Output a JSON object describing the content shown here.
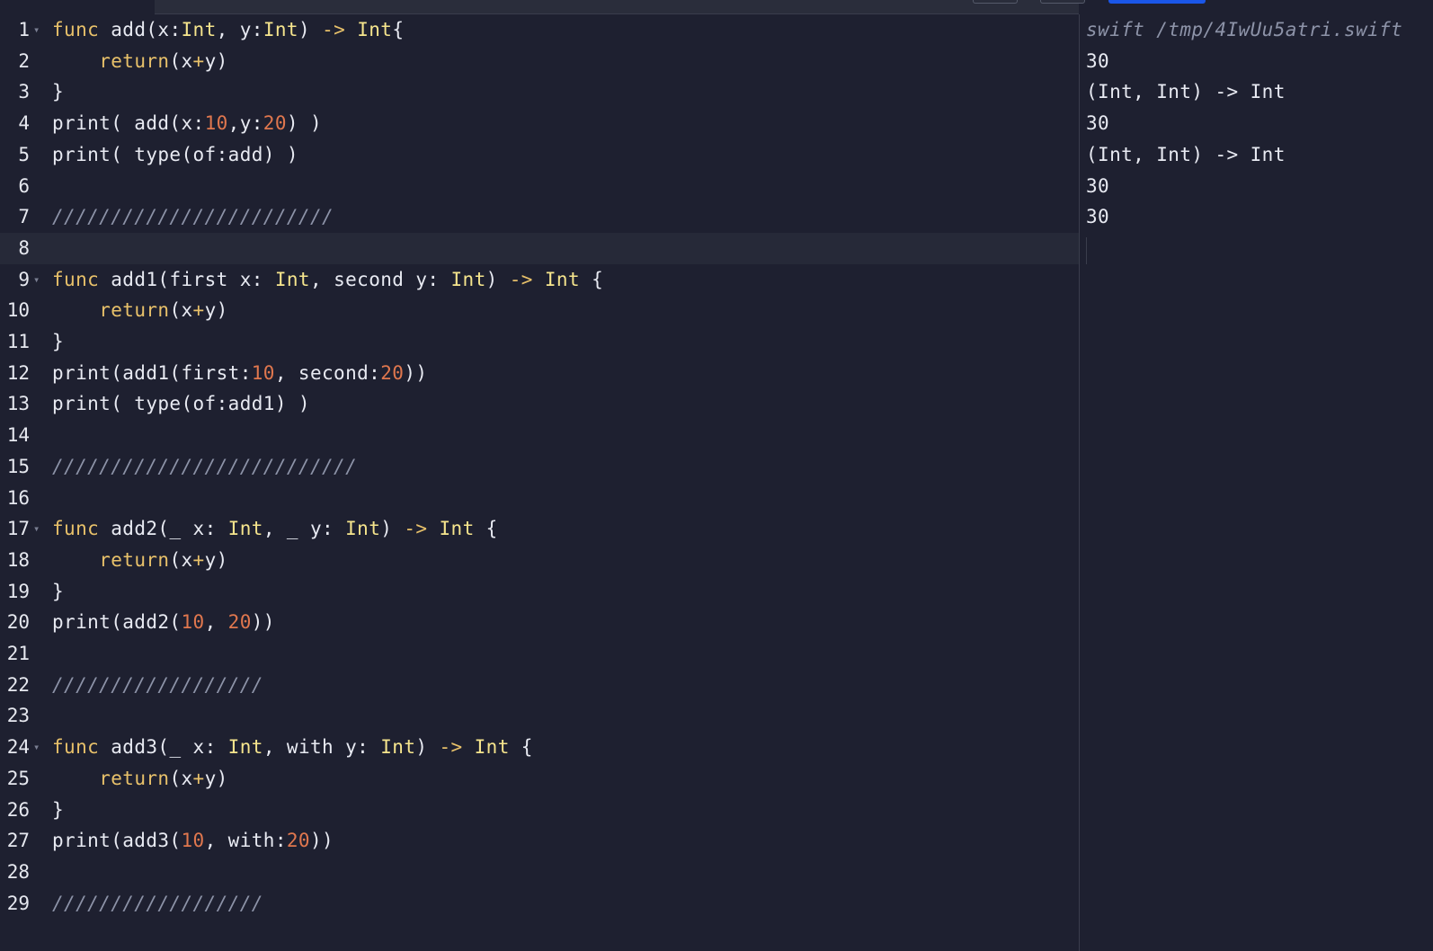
{
  "editor": {
    "lines": [
      {
        "n": "1",
        "fold": true,
        "tokens": [
          [
            "kw",
            "func"
          ],
          [
            "t",
            " add(x:"
          ],
          [
            "ty",
            "Int"
          ],
          [
            "t",
            ", y:"
          ],
          [
            "ty",
            "Int"
          ],
          [
            "t",
            ") "
          ],
          [
            "op",
            "->"
          ],
          [
            "t",
            " "
          ],
          [
            "ty",
            "Int"
          ],
          [
            "t",
            "{"
          ]
        ]
      },
      {
        "n": "2",
        "fold": false,
        "tokens": [
          [
            "t",
            "    "
          ],
          [
            "kw",
            "return"
          ],
          [
            "t",
            "(x"
          ],
          [
            "op",
            "+"
          ],
          [
            "t",
            "y)"
          ]
        ]
      },
      {
        "n": "3",
        "fold": false,
        "tokens": [
          [
            "t",
            "}"
          ]
        ]
      },
      {
        "n": "4",
        "fold": false,
        "tokens": [
          [
            "t",
            "print( add(x:"
          ],
          [
            "num",
            "10"
          ],
          [
            "t",
            ",y:"
          ],
          [
            "num",
            "20"
          ],
          [
            "t",
            ") )"
          ]
        ]
      },
      {
        "n": "5",
        "fold": false,
        "tokens": [
          [
            "t",
            "print( type(of:add) )"
          ]
        ]
      },
      {
        "n": "6",
        "fold": false,
        "tokens": []
      },
      {
        "n": "7",
        "fold": false,
        "tokens": [
          [
            "cm",
            "////////////////////////"
          ]
        ]
      },
      {
        "n": "8",
        "fold": false,
        "active": true,
        "tokens": []
      },
      {
        "n": "9",
        "fold": true,
        "tokens": [
          [
            "kw",
            "func"
          ],
          [
            "t",
            " add1(first x: "
          ],
          [
            "ty",
            "Int"
          ],
          [
            "t",
            ", second y: "
          ],
          [
            "ty",
            "Int"
          ],
          [
            "t",
            ") "
          ],
          [
            "op",
            "->"
          ],
          [
            "t",
            " "
          ],
          [
            "ty",
            "Int"
          ],
          [
            "t",
            " {"
          ]
        ]
      },
      {
        "n": "10",
        "fold": false,
        "tokens": [
          [
            "t",
            "    "
          ],
          [
            "kw",
            "return"
          ],
          [
            "t",
            "(x"
          ],
          [
            "op",
            "+"
          ],
          [
            "t",
            "y)"
          ]
        ]
      },
      {
        "n": "11",
        "fold": false,
        "tokens": [
          [
            "t",
            "}"
          ]
        ]
      },
      {
        "n": "12",
        "fold": false,
        "tokens": [
          [
            "t",
            "print(add1(first:"
          ],
          [
            "num",
            "10"
          ],
          [
            "t",
            ", second:"
          ],
          [
            "num",
            "20"
          ],
          [
            "t",
            "))"
          ]
        ]
      },
      {
        "n": "13",
        "fold": false,
        "tokens": [
          [
            "t",
            "print( type(of:add1) )"
          ]
        ]
      },
      {
        "n": "14",
        "fold": false,
        "tokens": []
      },
      {
        "n": "15",
        "fold": false,
        "tokens": [
          [
            "cm",
            "//////////////////////////"
          ]
        ]
      },
      {
        "n": "16",
        "fold": false,
        "tokens": []
      },
      {
        "n": "17",
        "fold": true,
        "tokens": [
          [
            "kw",
            "func"
          ],
          [
            "t",
            " add2(_ x: "
          ],
          [
            "ty",
            "Int"
          ],
          [
            "t",
            ", _ y: "
          ],
          [
            "ty",
            "Int"
          ],
          [
            "t",
            ") "
          ],
          [
            "op",
            "->"
          ],
          [
            "t",
            " "
          ],
          [
            "ty",
            "Int"
          ],
          [
            "t",
            " {"
          ]
        ]
      },
      {
        "n": "18",
        "fold": false,
        "tokens": [
          [
            "t",
            "    "
          ],
          [
            "kw",
            "return"
          ],
          [
            "t",
            "(x"
          ],
          [
            "op",
            "+"
          ],
          [
            "t",
            "y)"
          ]
        ]
      },
      {
        "n": "19",
        "fold": false,
        "tokens": [
          [
            "t",
            "}"
          ]
        ]
      },
      {
        "n": "20",
        "fold": false,
        "tokens": [
          [
            "t",
            "print(add2("
          ],
          [
            "num",
            "10"
          ],
          [
            "t",
            ", "
          ],
          [
            "num",
            "20"
          ],
          [
            "t",
            "))"
          ]
        ]
      },
      {
        "n": "21",
        "fold": false,
        "tokens": []
      },
      {
        "n": "22",
        "fold": false,
        "tokens": [
          [
            "cm",
            "//////////////////"
          ]
        ]
      },
      {
        "n": "23",
        "fold": false,
        "tokens": []
      },
      {
        "n": "24",
        "fold": true,
        "tokens": [
          [
            "kw",
            "func"
          ],
          [
            "t",
            " add3(_ x: "
          ],
          [
            "ty",
            "Int"
          ],
          [
            "t",
            ", with y: "
          ],
          [
            "ty",
            "Int"
          ],
          [
            "t",
            ") "
          ],
          [
            "op",
            "->"
          ],
          [
            "t",
            " "
          ],
          [
            "ty",
            "Int"
          ],
          [
            "t",
            " {"
          ]
        ]
      },
      {
        "n": "25",
        "fold": false,
        "tokens": [
          [
            "t",
            "    "
          ],
          [
            "kw",
            "return"
          ],
          [
            "t",
            "(x"
          ],
          [
            "op",
            "+"
          ],
          [
            "t",
            "y)"
          ]
        ]
      },
      {
        "n": "26",
        "fold": false,
        "tokens": [
          [
            "t",
            "}"
          ]
        ]
      },
      {
        "n": "27",
        "fold": false,
        "tokens": [
          [
            "t",
            "print(add3("
          ],
          [
            "num",
            "10"
          ],
          [
            "t",
            ", with:"
          ],
          [
            "num",
            "20"
          ],
          [
            "t",
            "))"
          ]
        ]
      },
      {
        "n": "28",
        "fold": false,
        "tokens": []
      },
      {
        "n": "29",
        "fold": false,
        "tokens": [
          [
            "cm",
            "//////////////////"
          ]
        ]
      }
    ]
  },
  "output": {
    "command": "swift /tmp/4IwUu5atri.swift",
    "lines": [
      "30",
      "(Int, Int) -> Int",
      "30",
      "(Int, Int) -> Int",
      "30",
      "30"
    ]
  },
  "colors": {
    "background": "#1e2030",
    "keyword": "#e8c16a",
    "type": "#f6e58d",
    "number": "#e0774e",
    "comment": "#8d93a8",
    "run_button": "#1a56e8"
  }
}
